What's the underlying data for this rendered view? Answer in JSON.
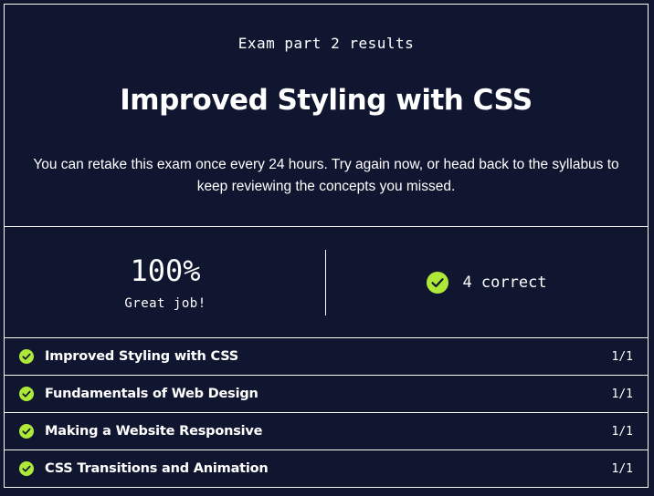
{
  "header": {
    "eyebrow": "Exam part 2 results",
    "title": "Improved Styling with CSS",
    "description": "You can retake this exam once every 24 hours. Try again now, or head back to the syllabus to keep reviewing the concepts you missed."
  },
  "summary": {
    "score": "100%",
    "message": "Great job!",
    "correct_icon": "check-circle-icon",
    "correct_text": "4 correct"
  },
  "results": [
    {
      "label": "Improved Styling with CSS",
      "score": "1/1",
      "icon": "check-circle-icon"
    },
    {
      "label": "Fundamentals of Web Design",
      "score": "1/1",
      "icon": "check-circle-icon"
    },
    {
      "label": "Making a Website Responsive",
      "score": "1/1",
      "icon": "check-circle-icon"
    },
    {
      "label": "CSS Transitions and Animation",
      "score": "1/1",
      "icon": "check-circle-icon"
    }
  ],
  "colors": {
    "background": "#10162f",
    "text": "#ffffff",
    "success": "#aee938"
  }
}
